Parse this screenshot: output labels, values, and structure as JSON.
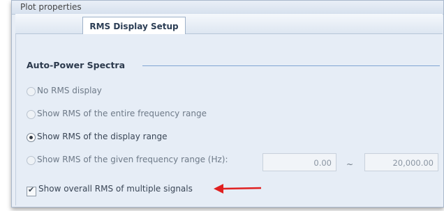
{
  "window": {
    "title": "Plot properties"
  },
  "tabs": [
    {
      "label": "RMS Display Setup",
      "selected": true
    }
  ],
  "section": {
    "title": "Auto-Power Spectra"
  },
  "options": [
    {
      "label": "No RMS display",
      "selected": false
    },
    {
      "label": "Show RMS of the entire frequency range",
      "selected": false
    },
    {
      "label": "Show RMS of the display range",
      "selected": true
    },
    {
      "label": "Show RMS of the given frequency range (Hz):",
      "selected": false
    }
  ],
  "range": {
    "from": "0.00",
    "separator": "~",
    "to": "20,000.00"
  },
  "overall": {
    "label": "Show overall RMS of multiple signals",
    "checked": true,
    "check_glyph": "✔"
  },
  "colors": {
    "accent": "#7fa4d2",
    "annotation_arrow": "#e02020"
  }
}
